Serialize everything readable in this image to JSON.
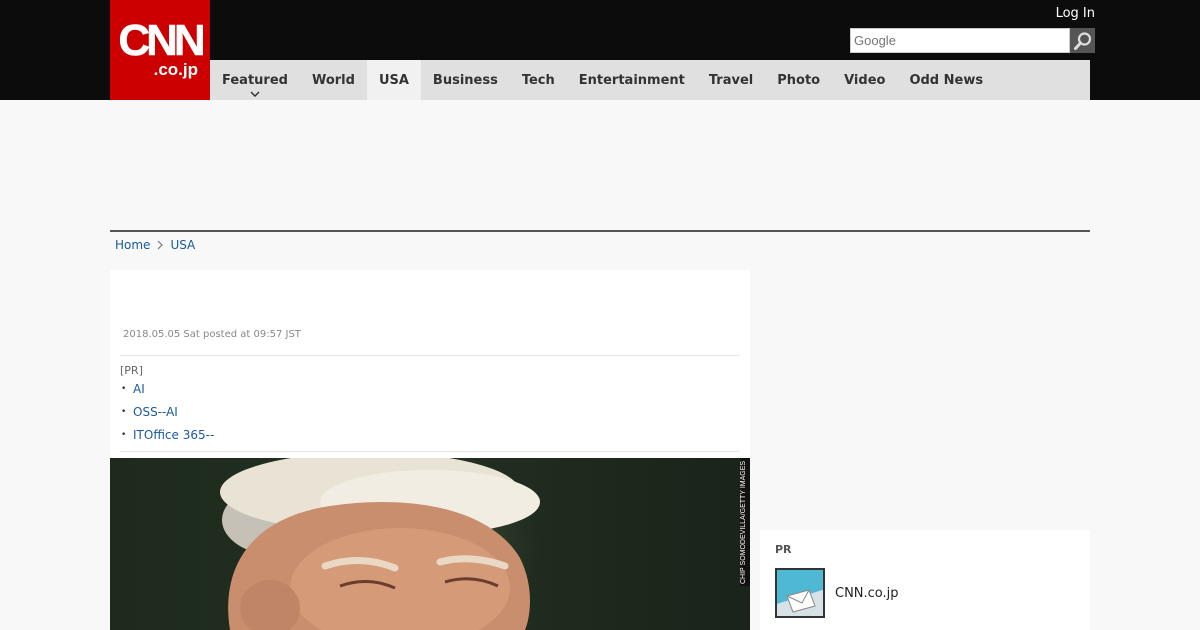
{
  "header": {
    "logo_main": "CNN",
    "logo_sub": ".co.jp",
    "login": "Log In",
    "search": {
      "placeholder": "Google"
    }
  },
  "nav": {
    "items": [
      {
        "label": "Featured"
      },
      {
        "label": "World"
      },
      {
        "label": "USA"
      },
      {
        "label": "Business"
      },
      {
        "label": "Tech"
      },
      {
        "label": "Entertainment"
      },
      {
        "label": "Travel"
      },
      {
        "label": "Photo"
      },
      {
        "label": "Video"
      },
      {
        "label": "Odd News"
      }
    ],
    "active": "USA"
  },
  "breadcrumb": {
    "home": "Home",
    "current": "USA"
  },
  "article": {
    "posted": "2018.05.05 Sat posted at 09:57 JST",
    "pr_label": "[PR]",
    "pr_links": [
      "AI",
      "OSS--AI",
      "ITOffice 365--"
    ],
    "photo_credit": "CHIP SOMODEVILLA/GETTY IMAGES"
  },
  "sidebar": {
    "pr_label": "PR",
    "item_text": "CNN.co.jp"
  },
  "colors": {
    "brand_red": "#cc0000",
    "header_bg": "#0c0c0c",
    "nav_bg": "#e0e0e0",
    "link": "#1a5a9a"
  },
  "icons": [
    "search-icon",
    "chevron-down-icon",
    "chevron-right-icon",
    "envelope-icon"
  ]
}
